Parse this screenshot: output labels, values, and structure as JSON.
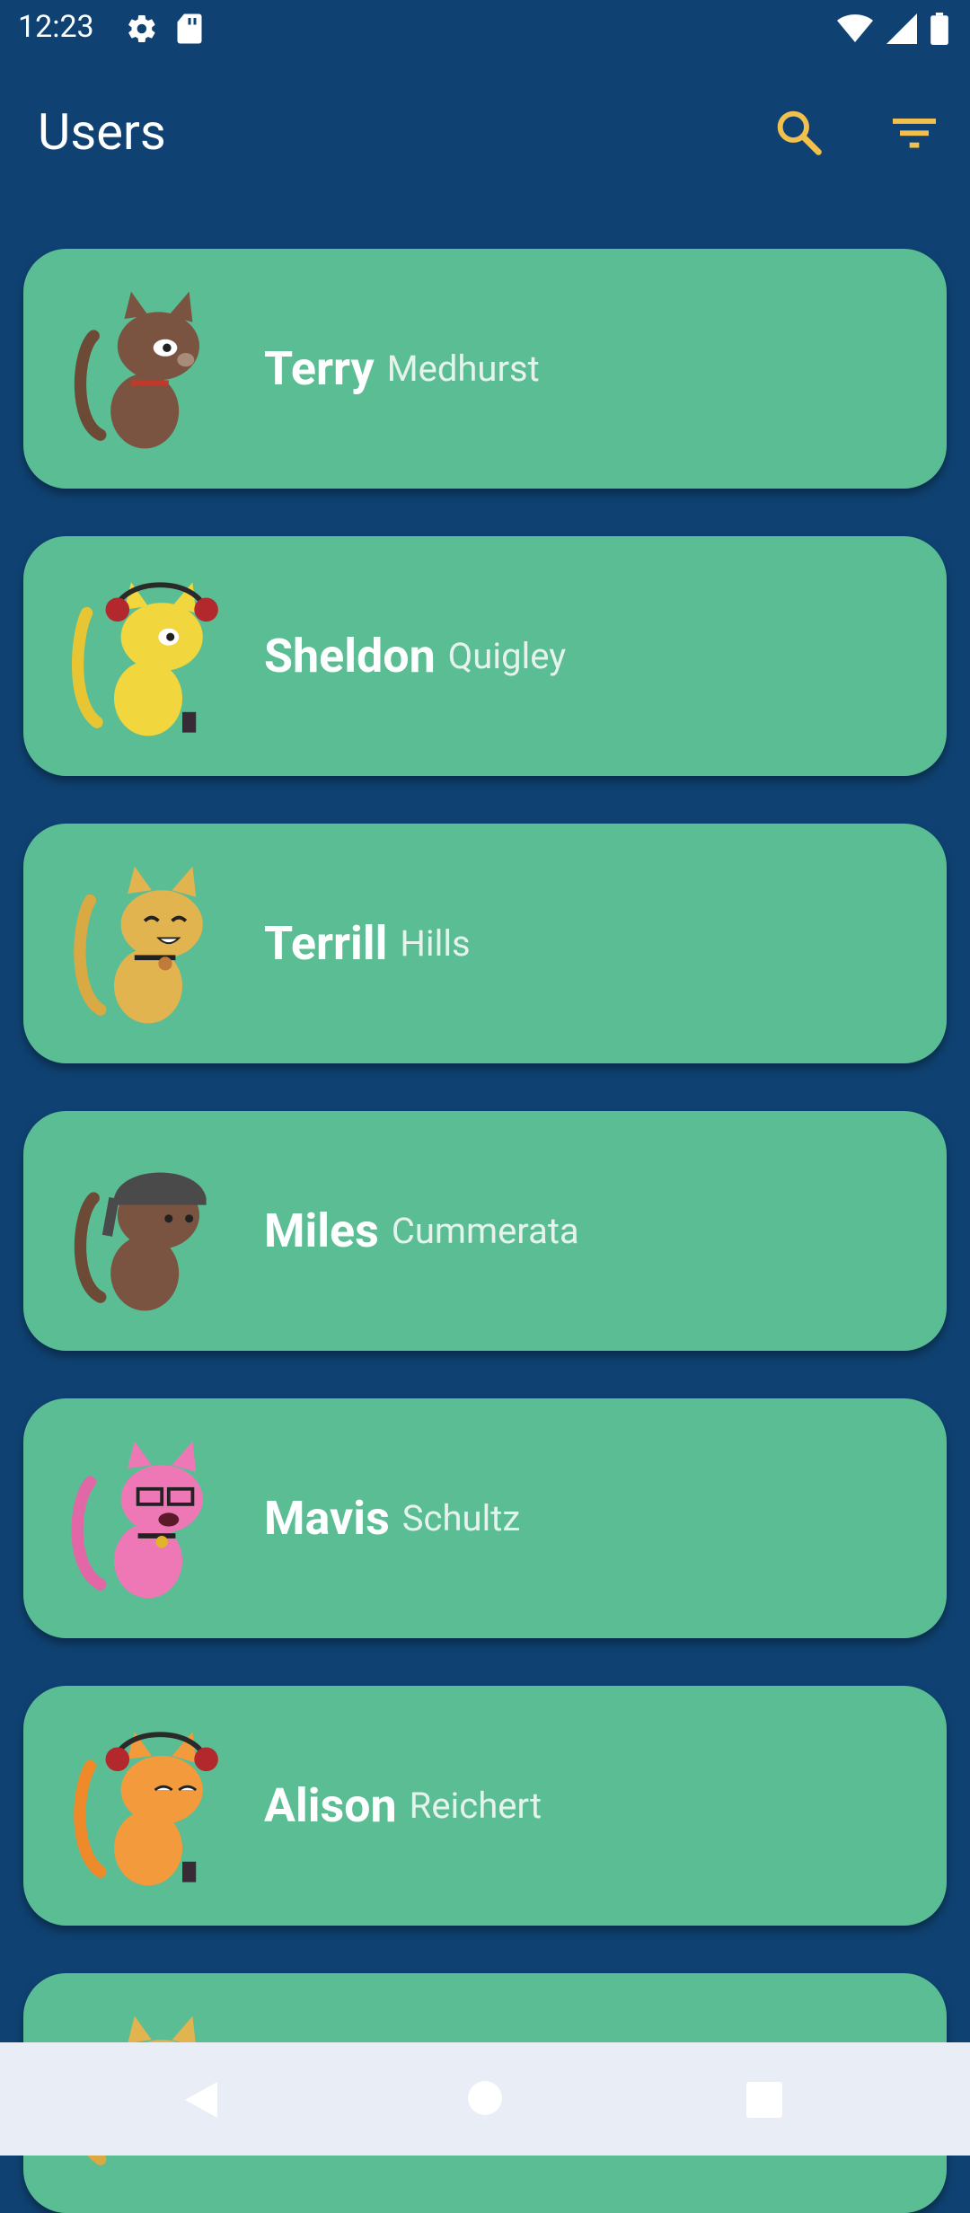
{
  "status": {
    "time": "12:23",
    "icons_left": [
      "gear-icon",
      "sd-card-icon"
    ],
    "icons_right": [
      "wifi-icon",
      "signal-icon",
      "battery-icon"
    ]
  },
  "app_bar": {
    "title": "Users",
    "actions": [
      "search-icon",
      "filter-icon"
    ],
    "accent": "#f2c04d",
    "background": "#0f4272"
  },
  "users": [
    {
      "first": "Terry",
      "last": "Medhurst",
      "avatar": "brown-cat"
    },
    {
      "first": "Sheldon",
      "last": "Quigley",
      "avatar": "yellow-cat-headphones"
    },
    {
      "first": "Terrill",
      "last": "Hills",
      "avatar": "golden-cat"
    },
    {
      "first": "Miles",
      "last": "Cummerata",
      "avatar": "brown-cat-bandana"
    },
    {
      "first": "Mavis",
      "last": "Schultz",
      "avatar": "pink-cat-glasses"
    },
    {
      "first": "Alison",
      "last": "Reichert",
      "avatar": "orange-cat-headphones"
    },
    {
      "first": "",
      "last": "",
      "avatar": "golden-cat"
    }
  ],
  "colors": {
    "card": "#5bbd94"
  },
  "nav": {
    "buttons": [
      "back-icon",
      "home-icon",
      "recents-icon"
    ]
  }
}
